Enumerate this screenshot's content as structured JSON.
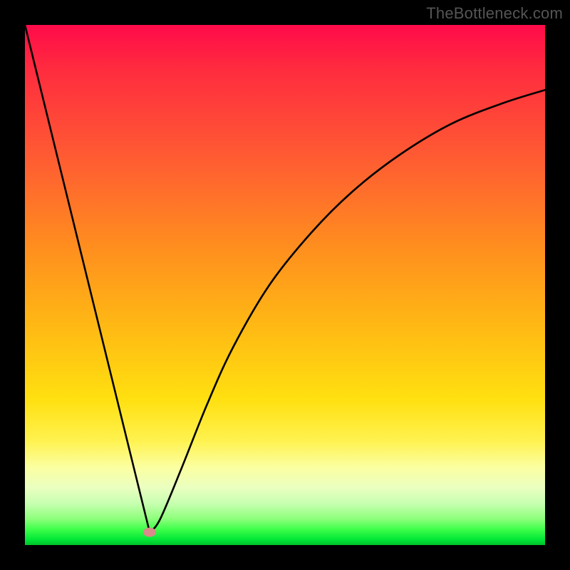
{
  "domain": "Chart",
  "watermark": "TheBottleneck.com",
  "colors": {
    "frame": "#000000",
    "curve_stroke": "#000000",
    "marker_fill": "#d98a8a",
    "watermark_text": "#555555"
  },
  "chart_data": {
    "type": "line",
    "title": "",
    "xlabel": "",
    "ylabel": "",
    "xlim": [
      0,
      100
    ],
    "ylim": [
      0,
      100
    ],
    "annotations": [
      {
        "kind": "marker",
        "x_pct": 24,
        "y_bottom_pct": 2.4,
        "shape": "ellipse",
        "color": "#d98a8a"
      }
    ],
    "series": [
      {
        "name": "bottleneck-curve",
        "stroke": "#000000",
        "points_pct_from_topleft": [
          {
            "x": 0.0,
            "y": 0.0
          },
          {
            "x": 24.0,
            "y": 97.6
          },
          {
            "x": 26.0,
            "y": 95.0
          },
          {
            "x": 30.0,
            "y": 85.5
          },
          {
            "x": 35.0,
            "y": 73.0
          },
          {
            "x": 40.0,
            "y": 62.0
          },
          {
            "x": 47.0,
            "y": 50.0
          },
          {
            "x": 55.0,
            "y": 40.0
          },
          {
            "x": 63.0,
            "y": 32.0
          },
          {
            "x": 72.0,
            "y": 25.0
          },
          {
            "x": 82.0,
            "y": 19.0
          },
          {
            "x": 92.0,
            "y": 15.0
          },
          {
            "x": 100.0,
            "y": 12.5
          }
        ]
      }
    ],
    "background_gradient_stops": [
      {
        "pos": 0,
        "color": "#ff0a4a"
      },
      {
        "pos": 8,
        "color": "#ff2a3f"
      },
      {
        "pos": 25,
        "color": "#ff5a33"
      },
      {
        "pos": 42,
        "color": "#ff8c1f"
      },
      {
        "pos": 58,
        "color": "#ffb914"
      },
      {
        "pos": 72,
        "color": "#ffe010"
      },
      {
        "pos": 80,
        "color": "#fff250"
      },
      {
        "pos": 85,
        "color": "#fbffa0"
      },
      {
        "pos": 89,
        "color": "#eaffc0"
      },
      {
        "pos": 92,
        "color": "#c7ffb0"
      },
      {
        "pos": 95,
        "color": "#8cff7a"
      },
      {
        "pos": 97,
        "color": "#3dff4a"
      },
      {
        "pos": 99,
        "color": "#00e636"
      },
      {
        "pos": 100,
        "color": "#00c22a"
      }
    ]
  }
}
